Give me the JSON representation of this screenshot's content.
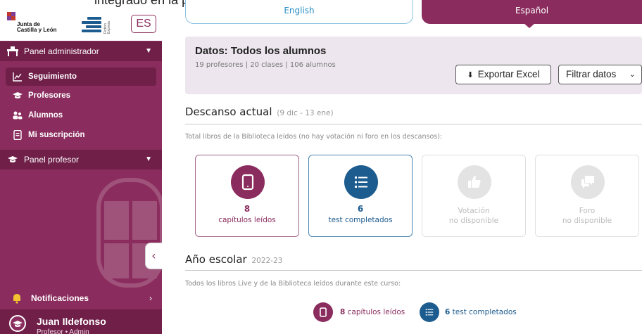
{
  "top_caption": "integrado en la plataforma mediante una serie de test.",
  "sidebar": {
    "logo_text": "Junta de\nCastilla y León",
    "fe_logo_text": "Fiction Express",
    "lang_button": "ES",
    "panel_admin": "Panel administrador",
    "items": [
      {
        "label": "Seguimiento"
      },
      {
        "label": "Profesores"
      },
      {
        "label": "Alumnos"
      },
      {
        "label": "Mi suscripción"
      }
    ],
    "panel_profesor": "Panel profesor",
    "notifications": "Notificaciones",
    "user_name": "Juan Ildefonso",
    "user_role": "Profesor • Admin",
    "accent": "#8a2c5d"
  },
  "lang_tabs": {
    "english": "English",
    "spanish": "Español"
  },
  "info": {
    "title": "Datos: Todos los alumnos",
    "subtitle": "19 profesores | 20 clases | 106 alumnos",
    "export_label": "Exportar Excel",
    "filter_label": "Filtrar datos"
  },
  "rest": {
    "title": "Descanso actual",
    "dates": "(9 dic - 13 ene)",
    "desc": "Total libros de la Biblioteca leídos (no hay votación ni foro en los descansos):",
    "cards": {
      "capitulos_num": "8",
      "capitulos_label": "capítulos leídos",
      "test_num": "6",
      "test_label": "test completados",
      "votacion_line1": "Votación",
      "votacion_line2": "no disponible",
      "foro_line1": "Foro",
      "foro_line2": "no disponible"
    }
  },
  "year": {
    "title": "Año escolar",
    "range": "2022-23",
    "desc": "Todos los libros Live y de la Biblioteca leídos durante este curso:",
    "cap_num": "8",
    "cap_label": "capítulos leídos",
    "test_num": "6",
    "test_label": "test completados"
  }
}
